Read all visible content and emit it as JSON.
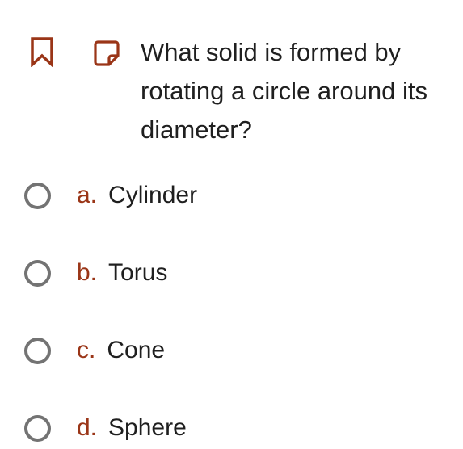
{
  "question": {
    "text": "What solid is formed by rotating a circle around its diameter?"
  },
  "icons": {
    "bookmark": "bookmark-icon",
    "note": "note-icon"
  },
  "colors": {
    "accent": "#9a3517",
    "text": "#1f1f1f",
    "radio_border": "#737373"
  },
  "options": [
    {
      "letter": "a.",
      "text": "Cylinder"
    },
    {
      "letter": "b.",
      "text": "Torus"
    },
    {
      "letter": "c.",
      "text": "Cone"
    },
    {
      "letter": "d.",
      "text": "Sphere"
    }
  ]
}
